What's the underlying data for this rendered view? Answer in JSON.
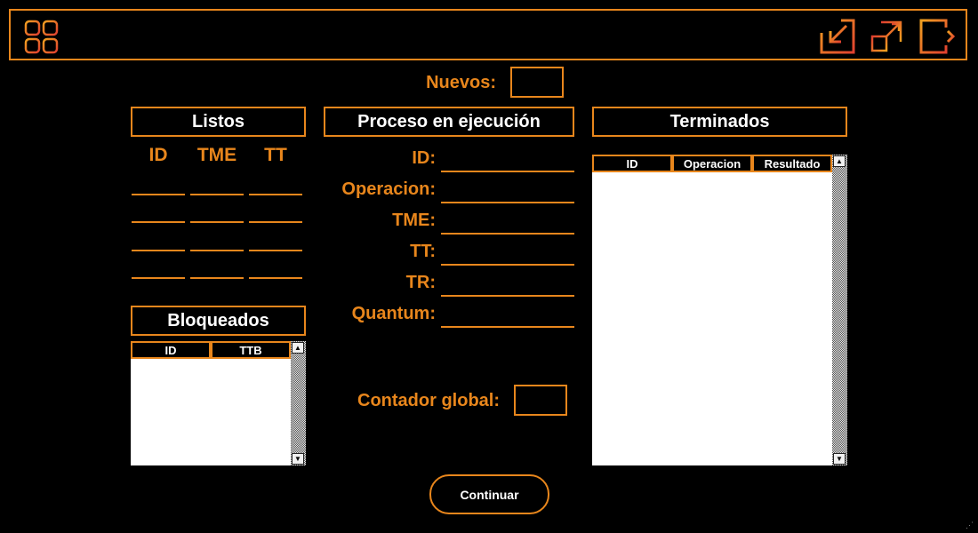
{
  "header": {
    "menu_icon": "grid-icon",
    "minimize_icon": "minimize-icon",
    "maximize_icon": "maximize-icon",
    "exit_icon": "exit-icon",
    "accent_color": "#e8861c"
  },
  "nuevos": {
    "label": "Nuevos:",
    "value": ""
  },
  "listos": {
    "title": "Listos",
    "columns": [
      "ID",
      "TME",
      "TT"
    ],
    "rows": [
      [
        "",
        "",
        ""
      ],
      [
        "",
        "",
        ""
      ],
      [
        "",
        "",
        ""
      ],
      [
        "",
        "",
        ""
      ]
    ]
  },
  "bloqueados": {
    "title": "Bloqueados",
    "columns": [
      "ID",
      "TTB"
    ]
  },
  "proceso": {
    "title": "Proceso en ejecución",
    "fields": [
      {
        "label": "ID:",
        "value": ""
      },
      {
        "label": "Operacion:",
        "value": ""
      },
      {
        "label": "TME:",
        "value": ""
      },
      {
        "label": "TT:",
        "value": ""
      },
      {
        "label": "TR:",
        "value": ""
      },
      {
        "label": "Quantum:",
        "value": ""
      }
    ]
  },
  "contador": {
    "label": "Contador global:",
    "value": ""
  },
  "terminados": {
    "title": "Terminados",
    "columns": [
      "ID",
      "Operacion",
      "Resultado"
    ]
  },
  "continuar_label": "Continuar"
}
